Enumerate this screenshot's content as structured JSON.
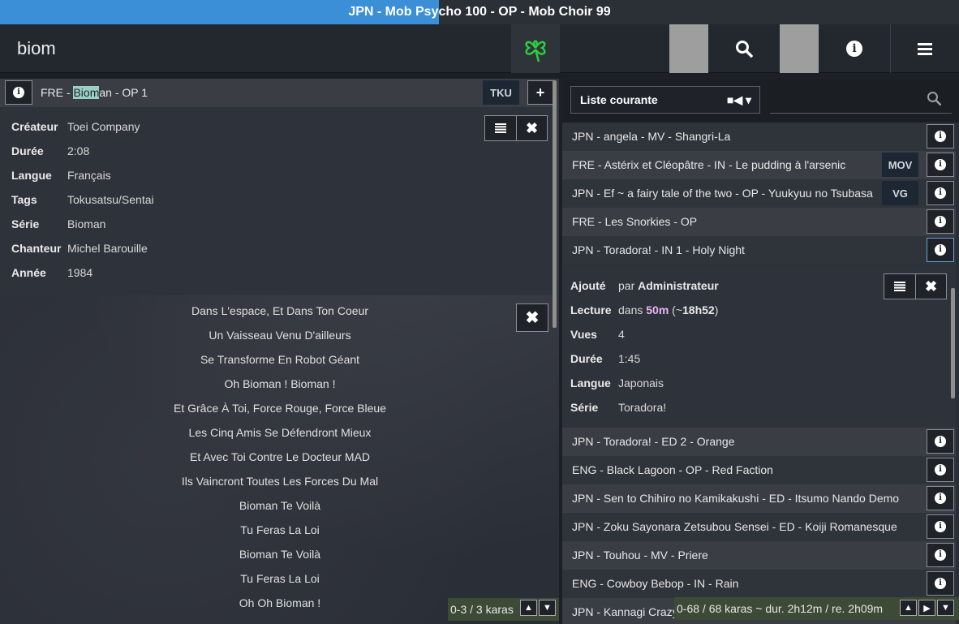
{
  "now_playing": {
    "title": "JPN - Mob Psycho 100 - OP - Mob Choir 99",
    "progress_percent": 45.8
  },
  "header": {
    "search_value": "biom",
    "icons": {
      "logo": "clover-icon",
      "search": "search-icon",
      "info": "info-icon",
      "menu": "hamburger-icon"
    },
    "colors": {
      "accent": "#3a8fd6",
      "logo": "#2ecc40"
    }
  },
  "left": {
    "kara": {
      "prefix": "FRE - ",
      "highlight": "Biom",
      "suffix": "an - OP 1",
      "tag": "TKU"
    },
    "details": [
      {
        "label": "Créateur",
        "value": "Toei Company"
      },
      {
        "label": "Durée",
        "value": "2:08"
      },
      {
        "label": "Langue",
        "value": "Français"
      },
      {
        "label": "Tags",
        "value": "Tokusatsu/Sentai"
      },
      {
        "label": "Série",
        "value": "Bioman"
      },
      {
        "label": "Chanteur",
        "value": "Michel Barouille"
      },
      {
        "label": "Année",
        "value": "1984"
      }
    ],
    "lyrics": [
      "Dans L'espace, Et Dans Ton Coeur",
      "Un Vaisseau Venu D'ailleurs",
      "Se Transforme En Robot Géant",
      "Oh Bioman ! Bioman !",
      "Et Grâce À Toi, Force Rouge, Force Bleue",
      "Les Cinq Amis Se Défendront Mieux",
      "Et Avec Toi Contre Le Docteur MAD",
      "Ils Vaincront Toutes Les Forces Du Mal",
      "Bioman Te Voilà",
      "Tu Feras La Loi",
      "Bioman Te Voilà",
      "Tu Feras La Loi",
      "Oh Oh Bioman !"
    ],
    "counter": "0-3 / 3 karas"
  },
  "right": {
    "playlist_label": "Liste courante",
    "rows_top": [
      {
        "text": "JPN - angela - MV - Shangri-La",
        "tag": ""
      },
      {
        "text": "FRE - Astérix et Cléopâtre - IN - Le pudding à l'arsenic",
        "tag": "MOV"
      },
      {
        "text": "JPN - Ef ~ a fairy tale of the two - OP - Yuukyuu no Tsubasa",
        "tag": "VG"
      },
      {
        "text": "FRE - Les Snorkies - OP",
        "tag": ""
      },
      {
        "text": "JPN - Toradora! - IN 1 - Holy Night",
        "tag": ""
      }
    ],
    "details": {
      "added_label": "Ajouté",
      "added_prefix": "par ",
      "added_by": "Administrateur",
      "play_label": "Lecture",
      "play_prefix": "dans ",
      "play_in": "50m",
      "play_paren_open": " (~",
      "play_time": "18h52",
      "play_paren_close": ")",
      "views_label": "Vues",
      "views": "4",
      "duration_label": "Durée",
      "duration": "1:45",
      "lang_label": "Langue",
      "lang": "Japonais",
      "series_label": "Série",
      "series": "Toradora!"
    },
    "rows_bottom": [
      "JPN - Toradora! - ED 2 - Orange",
      "ENG - Black Lagoon - OP - Red Faction",
      "JPN - Sen to Chihiro no Kamikakushi - ED - Itsumo Nando Demo",
      "JPN - Zoku Sayonara Zetsubou Sensei - ED - Koiji Romanesque",
      "JPN - Touhou - MV - Priere",
      "ENG - Cowboy Bebop - IN - Rain",
      "JPN - Kannagi Crazy"
    ],
    "counter": "0-68 / 68 karas ~ dur. 2h12m / re. 2h09m"
  }
}
